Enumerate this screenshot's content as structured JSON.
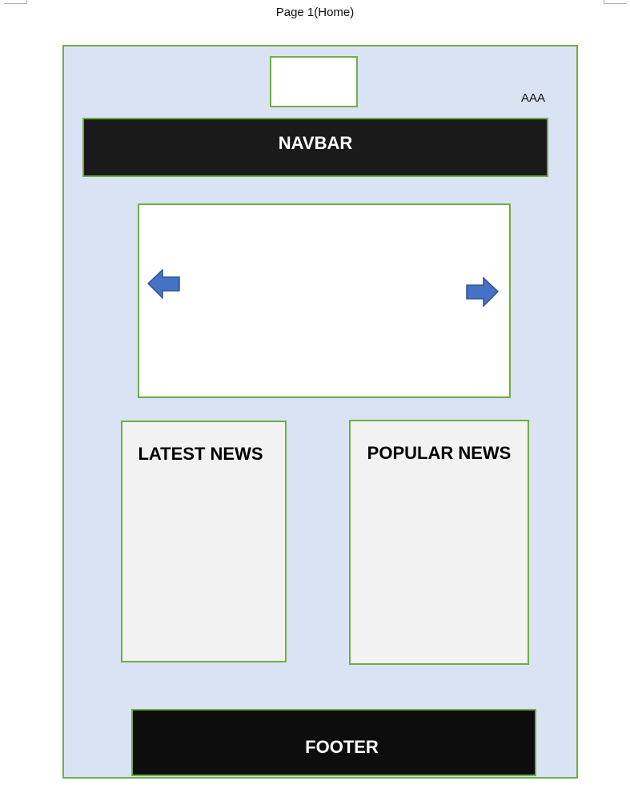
{
  "page_caption": "Page 1(Home)",
  "header": {
    "logo_box": "",
    "accessibility_label": "AAA"
  },
  "navbar": {
    "label": "NAVBAR"
  },
  "slider": {
    "prev_arrow_icon": "arrow-left-icon",
    "next_arrow_icon": "arrow-right-icon",
    "arrow_color": "#4472c4"
  },
  "sections": {
    "latest_news": "LATEST NEWS",
    "popular_news": "POPULAR NEWS"
  },
  "footer": {
    "label": "FOOTER"
  },
  "colors": {
    "border_green": "#70ad47",
    "page_background": "#dae3f3",
    "bar_background": "#1a1a1a",
    "box_background": "#f2f2f2"
  }
}
